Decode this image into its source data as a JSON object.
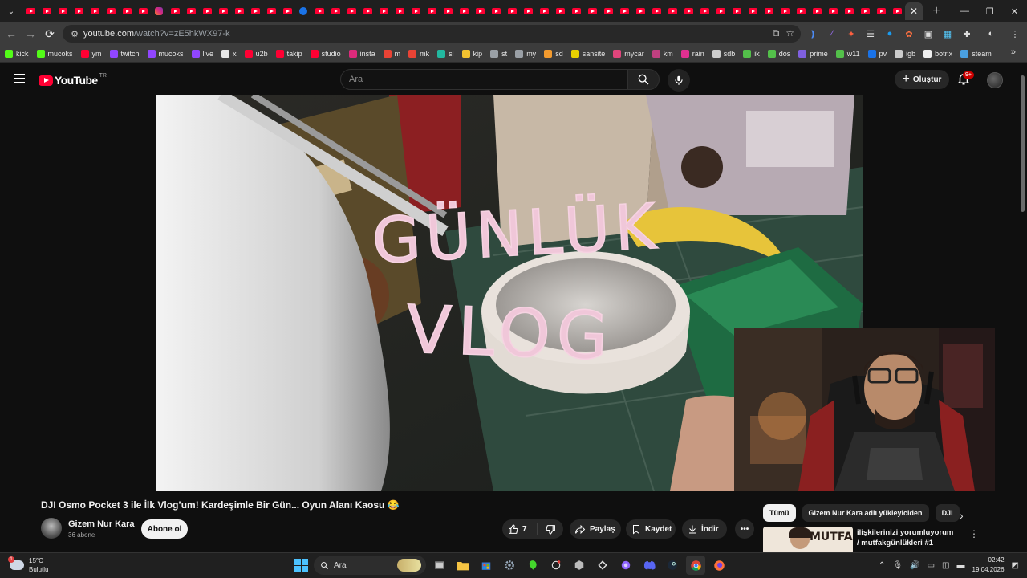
{
  "browser": {
    "url_domain": "youtube.com",
    "url_path": "/watch?v=zE5hkWX97-k",
    "bookmarks": [
      {
        "label": "kick",
        "color": "#53fc18"
      },
      {
        "label": "mucoks",
        "color": "#53fc18"
      },
      {
        "label": "ym",
        "color": "#ff0033"
      },
      {
        "label": "twitch",
        "color": "#9146ff"
      },
      {
        "label": "mucoks",
        "color": "#9146ff"
      },
      {
        "label": "live",
        "color": "#9146ff"
      },
      {
        "label": "x",
        "color": "#e7e7e7"
      },
      {
        "label": "u2b",
        "color": "#ff0033"
      },
      {
        "label": "takip",
        "color": "#ff0033"
      },
      {
        "label": "studio",
        "color": "#ff0033"
      },
      {
        "label": "insta",
        "color": "#dd2a7b"
      },
      {
        "label": "m",
        "color": "#ea4335"
      },
      {
        "label": "mk",
        "color": "#ea4335"
      },
      {
        "label": "sl",
        "color": "#22b8a0"
      },
      {
        "label": "kip",
        "color": "#f2c230"
      },
      {
        "label": "st",
        "color": "#9aa0a6"
      },
      {
        "label": "my",
        "color": "#9aa0a6"
      },
      {
        "label": "sd",
        "color": "#f29a2e"
      },
      {
        "label": "sansite",
        "color": "#e8d000"
      },
      {
        "label": "mycar",
        "color": "#e0457b"
      },
      {
        "label": "km",
        "color": "#c04080"
      },
      {
        "label": "rain",
        "color": "#e03090"
      },
      {
        "label": "sdb",
        "color": "#cccccc"
      },
      {
        "label": "ik",
        "color": "#53c04a"
      },
      {
        "label": "dos",
        "color": "#53c04a"
      },
      {
        "label": "prime",
        "color": "#8060e0"
      },
      {
        "label": "w11",
        "color": "#53c04a"
      },
      {
        "label": "pv",
        "color": "#1a73e8"
      },
      {
        "label": "igb",
        "color": "#cccccc"
      },
      {
        "label": "botrix",
        "color": "#eeeeee"
      },
      {
        "label": "steam",
        "color": "#4aa0e0"
      }
    ]
  },
  "youtube": {
    "logo_text": "YouTube",
    "country_code": "TR",
    "search_placeholder": "Ara",
    "create_label": "Oluştur",
    "notifications_badge": "9+"
  },
  "video": {
    "overlay_line1": "GÜNLÜK",
    "overlay_line2": "VLOG",
    "title": "DJI Osmo Pocket 3 ile İlk Vlog’um! Kardeşimle Bir Gün... Oyun Alanı Kaosu 😂",
    "channel_name": "Gizem Nur Kara",
    "subscribers": "36 abone",
    "subscribe_label": "Abone ol",
    "like_count": "7",
    "share_label": "Paylaş",
    "save_label": "Kaydet",
    "download_label": "İndir"
  },
  "sidebar": {
    "chips": [
      "Tümü",
      "Gizem Nur Kara adlı yükleyiciden",
      "DJI"
    ],
    "rec_title": "ilişkilerinizi yorumluyorum / mutfakgünlükleri #1",
    "rec_thumb_text": "MUTFAK"
  },
  "taskbar": {
    "temperature": "15°C",
    "weather": "Bulutlu",
    "weather_badge": "1",
    "search_label": "Ara",
    "time": "02:42",
    "date": "19.04.2026"
  }
}
